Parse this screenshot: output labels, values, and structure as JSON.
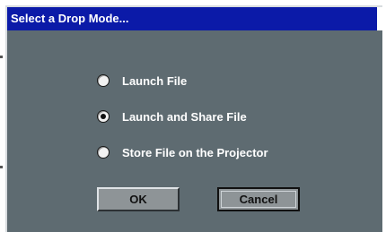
{
  "dialog": {
    "title": "Select a Drop Mode...",
    "options": [
      {
        "label": "Launch File",
        "checked": false
      },
      {
        "label": "Launch and Share File",
        "checked": true
      },
      {
        "label": "Store File on the Projector",
        "checked": false
      }
    ],
    "ok_label": "OK",
    "cancel_label": "Cancel"
  },
  "colors": {
    "titlebar": "#0b1aa8",
    "dialog_background": "#5e6b71",
    "button_face": "#8e9497",
    "label_text": "#ffffff"
  }
}
